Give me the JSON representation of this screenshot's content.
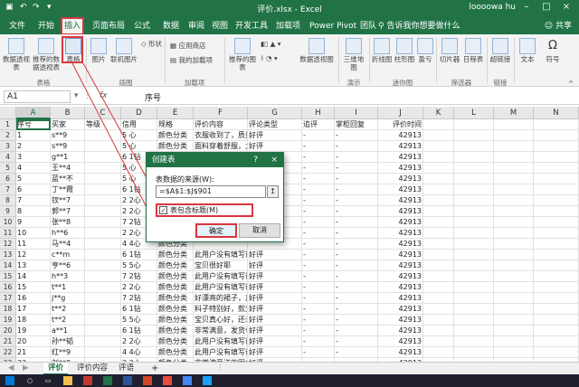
{
  "titlebar": {
    "title": "评价.xlsx - Excel",
    "user": "loooowa hu",
    "save_icon": "save-icon",
    "undo_icon": "undo-icon",
    "redo_icon": "redo-icon"
  },
  "tabs": [
    "文件",
    "开始",
    "插入",
    "页面布局",
    "公式",
    "数据",
    "审阅",
    "视图",
    "开发工具",
    "加载项",
    "Power Pivot",
    "团队"
  ],
  "tellme": "告诉我你想要做什么",
  "share": "共享",
  "ribbon": {
    "pivot": "数据透视表",
    "recommended_pivot": "推荐的数据透视表",
    "table": "表格",
    "picture": "图片",
    "online_picture": "联机图片",
    "shapes": "形状",
    "get_addins": "应用商店",
    "my_addins": "我的加载项",
    "recommended_charts": "推荐的图表",
    "pivot_chart": "数据透视图",
    "map3d": "三维地图",
    "line": "折线图",
    "column": "柱形图",
    "winloss": "盈亏",
    "slicer": "切片器",
    "timeline": "日程表",
    "hyperlink": "超链接",
    "text": "文本",
    "symbols": "符号",
    "group_tables": "表格",
    "group_illustrations": "插图",
    "group_addins": "加载项",
    "group_tours": "演示",
    "group_sparklines": "迷你图",
    "group_filters": "筛选器",
    "group_links": "链接"
  },
  "formula": {
    "namebox": "A1",
    "fx": "fx",
    "content": "序号"
  },
  "columns": [
    "A",
    "B",
    "C",
    "D",
    "E",
    "F",
    "G",
    "H",
    "I",
    "J",
    "K",
    "L",
    "M",
    "N"
  ],
  "rows": [
    [
      "序号",
      "买家",
      "等级",
      "信用",
      "规格",
      "评价内容",
      "评论类型",
      "追评",
      "掌柜回复",
      "评价时间"
    ],
    [
      "1",
      "s**9",
      "",
      "5 心",
      "颜色分类",
      "衣服收到了，质量",
      "好评",
      "-",
      "-",
      "42913"
    ],
    [
      "2",
      "s**9",
      "",
      "5 心",
      "颜色分类",
      "面料穿着舒服，大",
      "好评",
      "-",
      "-",
      "42913"
    ],
    [
      "3",
      "g**1",
      "",
      "6 1钻",
      "颜色分类",
      "",
      "",
      "-",
      "-",
      "42913"
    ],
    [
      "4",
      "王**4",
      "",
      "5 心",
      "颜色分类",
      "",
      "",
      "-",
      "-",
      "42913"
    ],
    [
      "5",
      "蓝**不",
      "",
      "5 心",
      "颜色分类",
      "",
      "",
      "-",
      "-",
      "42913"
    ],
    [
      "6",
      "丁**霞",
      "",
      "6 1钻",
      "颜色分类",
      "",
      "",
      "-",
      "-",
      "42913"
    ],
    [
      "7",
      "钗**7",
      "",
      "2 2心",
      "颜色分类",
      "",
      "",
      "-",
      "-",
      "42913"
    ],
    [
      "8",
      "郭**7",
      "",
      "2 2心",
      "颜色分类",
      "",
      "",
      "-",
      "-",
      "42913"
    ],
    [
      "9",
      "张**8",
      "",
      "7 2钻",
      "颜色分类",
      "",
      "",
      "-",
      "-",
      "42913"
    ],
    [
      "10",
      "h**6",
      "",
      "2 2心",
      "颜色分类",
      "",
      "",
      "-",
      "-",
      "42913"
    ],
    [
      "11",
      "马**4",
      "",
      "4 4心",
      "颜色分类",
      "",
      "",
      "-",
      "-",
      "42913"
    ],
    [
      "12",
      "c**m",
      "",
      "6 1钻",
      "颜色分类",
      "此用户没有填写评",
      "好评",
      "-",
      "-",
      "42913"
    ],
    [
      "13",
      "亨**6",
      "",
      "5 5心",
      "颜色分类",
      "宝贝很好耶",
      "好评",
      "-",
      "-",
      "42913"
    ],
    [
      "14",
      "h**3",
      "",
      "7 2钻",
      "颜色分类",
      "此用户没有填写评",
      "好评",
      "-",
      "-",
      "42913"
    ],
    [
      "15",
      "t**1",
      "",
      "2 2心",
      "颜色分类",
      "此用户没有填写评",
      "好评",
      "-",
      "-",
      "42913"
    ],
    [
      "16",
      "j**g",
      "",
      "7 2钻",
      "颜色分类",
      "好漂亮的裙子，真",
      "好评",
      "-",
      "-",
      "42913"
    ],
    [
      "17",
      "t**2",
      "",
      "6 1钻",
      "颜色分类",
      "料子特别好，款式",
      "好评",
      "-",
      "-",
      "42913"
    ],
    [
      "18",
      "t**2",
      "",
      "5 5心",
      "颜色分类",
      "宝贝真心好，还未",
      "好评",
      "-",
      "-",
      "42913"
    ],
    [
      "19",
      "a**1",
      "",
      "6 1钻",
      "颜色分类",
      "非常满意，发货也",
      "好评",
      "-",
      "-",
      "42913"
    ],
    [
      "20",
      "孙**韬",
      "",
      "2 2心",
      "颜色分类",
      "此用户没有填写评",
      "好评",
      "-",
      "-",
      "42913"
    ],
    [
      "21",
      "红**9",
      "",
      "4 4心",
      "颜色分类",
      "此用户没有填写评",
      "好评",
      "-",
      "-",
      "42913"
    ],
    [
      "22",
      "刘**8",
      "",
      "2 2心",
      "颜色分类",
      "非常满意送的围巾",
      "好评",
      "-",
      "-",
      "42913"
    ],
    [
      "23",
      "a**7",
      "",
      "2 2心",
      "颜色分类",
      "发货大慢了，穿着",
      "好评",
      "-",
      "-",
      "42913"
    ]
  ],
  "dialog": {
    "title": "创建表",
    "help": "?",
    "close": "×",
    "label": "表数据的来源(W):",
    "range": "=$A$1:$J$901",
    "picker": "↥",
    "checkbox_label": "表包含标题(M)",
    "checked": "✓",
    "ok": "确定",
    "cancel": "取消"
  },
  "sheets": [
    "评价",
    "评价内容",
    "评语"
  ],
  "add_sheet": "+",
  "taskbar_icons": [
    "windows-icon",
    "search-icon",
    "taskview-icon",
    "explorer-icon",
    "edge-icon",
    "excel-icon",
    "word-icon",
    "powerpoint-icon",
    "xmind-icon",
    "chrome-icon",
    "qq-icon"
  ]
}
